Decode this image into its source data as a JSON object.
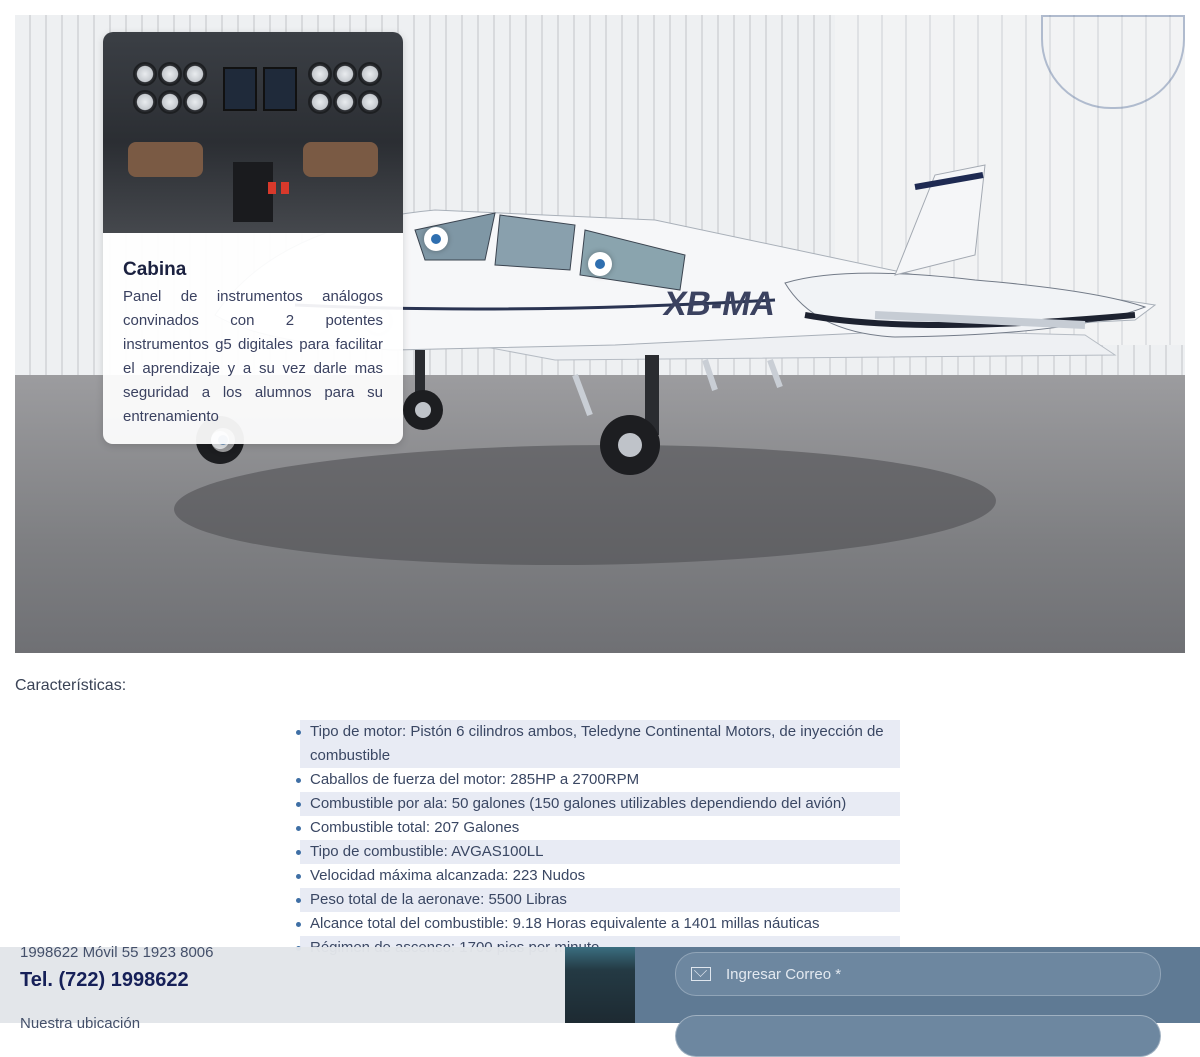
{
  "hero": {
    "popup": {
      "title": "Cabina",
      "description": "Panel de instrumentos análogos convinados con 2 potentes instrumentos g5 digitales para facilitar el aprendizaje y a su vez darle mas seguridad a los alumnos para su entrenamiento"
    },
    "aircraft_registration": "XB-MA"
  },
  "features": {
    "label": "Características:",
    "items": [
      "Tipo de motor: Pistón 6 cilindros ambos, Teledyne Continental Motors, de inyección de combustible",
      "Caballos de fuerza del motor: 285HP a 2700RPM",
      "Combustible por ala: 50 galones (150 galones utilizables dependiendo del avión)",
      "Combustible total: 207 Galones",
      "Tipo de combustible: AVGAS100LL",
      "Velocidad máxima alcanzada: 223 Nudos",
      "Peso total de la aeronave: 5500 Libras",
      "Alcance total del combustible: 9.18 Horas equivalente a 1401 millas náuticas",
      "Régimen de ascenso: 1700 pies por minuto"
    ]
  },
  "footer": {
    "phone_small": "1998622 Móvil 55 1923 8006",
    "phone_big": "Tel. (722) 1998622",
    "cut_text": "Nuestra ubicación",
    "email_placeholder": "Ingresar Correo *"
  }
}
